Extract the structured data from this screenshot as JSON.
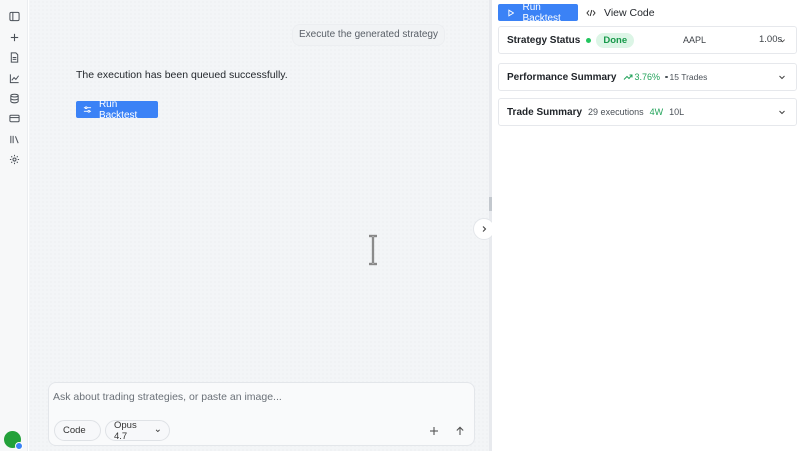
{
  "sidebar": {
    "icons": [
      {
        "name": "sidebar-toggle-icon"
      },
      {
        "name": "new-chat-icon"
      },
      {
        "name": "document-icon"
      },
      {
        "name": "chart-icon"
      },
      {
        "name": "database-icon"
      },
      {
        "name": "card-icon"
      },
      {
        "name": "library-icon"
      },
      {
        "name": "settings-icon"
      }
    ],
    "avatar_color": "#23a13a"
  },
  "chat": {
    "user_message": "Execute the generated strategy",
    "assistant_message": "The execution has been queued successfully.",
    "run_backtest_label": "Run Backtest"
  },
  "composer": {
    "placeholder": "Ask about trading strategies, or paste an image...",
    "mode": "Code",
    "model": "Opus 4.7"
  },
  "right_panel": {
    "run_backtest_label": "Run Backtest",
    "view_code_label": "View Code",
    "status_card": {
      "title": "Strategy Status",
      "status": "Done",
      "ticker": "AAPL",
      "latency": "1.00s"
    },
    "performance_card": {
      "title": "Performance Summary",
      "return": "3.76%",
      "trades": "15 Trades"
    },
    "trade_card": {
      "title": "Trade Summary",
      "executions": "29 executions",
      "wins": "4W",
      "losses": "10L"
    }
  },
  "colors": {
    "accent": "#3b82f6",
    "success": "#22a35a",
    "success_bg": "#dcf5e6"
  }
}
